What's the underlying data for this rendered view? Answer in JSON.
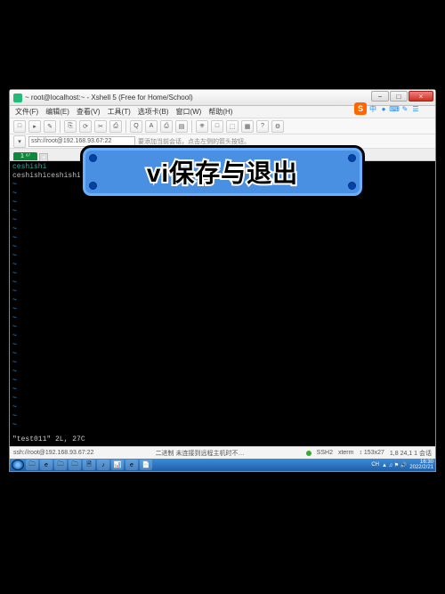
{
  "window": {
    "title": "~ root@localhost:~ - Xshell 5 (Free for Home/School)",
    "min": "−",
    "max": "□",
    "close": "×"
  },
  "menu": {
    "file": "文件(F)",
    "edit": "编辑(E)",
    "view": "查看(V)",
    "tools": "工具(T)",
    "tab": "选项卡(B)",
    "window": "窗口(W)",
    "help": "帮助(H)"
  },
  "toolbar_icons": [
    "□",
    "▸",
    "✎",
    "⎘",
    "⟳",
    "✂",
    "⎙",
    "Q",
    "A",
    "⎙",
    "▤",
    "⎈",
    "□",
    "⬚",
    "▦",
    "?",
    "⚙"
  ],
  "addr": {
    "value": "ssh://root@192.168.93.67:22"
  },
  "hint": "要添加当前会话，点击左侧的箭头按钮。",
  "tab": {
    "label": "1 ⁶⁷",
    "plus": "+"
  },
  "terminal": {
    "l1": "ceshishi",
    "l2": "ceshishiceshishi",
    "status": "\"test011\" 2L, 27C"
  },
  "statusbar": {
    "left": "ssh://root@192.168.93.67:22",
    "hint2": "二进制 未连接到远程主机时不…",
    "ssh": "SSH2",
    "term": "xterm",
    "size": "↕ 153x27",
    "enc": "1,8  24,1 1 会话"
  },
  "taskbar": {
    "icons": [
      "🗀",
      "e",
      "🗀",
      "🗀",
      "🗎",
      "♪",
      "📊",
      "e",
      "📄"
    ],
    "lang": "CH",
    "time": "16:30",
    "date": "2022/2/21"
  },
  "overlay": {
    "text": "vi保存与退出"
  },
  "sogou": {
    "s": "S",
    "i1": "中",
    "i2": "●",
    "i3": "⌨",
    "i4": "✎",
    "i5": "☰"
  }
}
